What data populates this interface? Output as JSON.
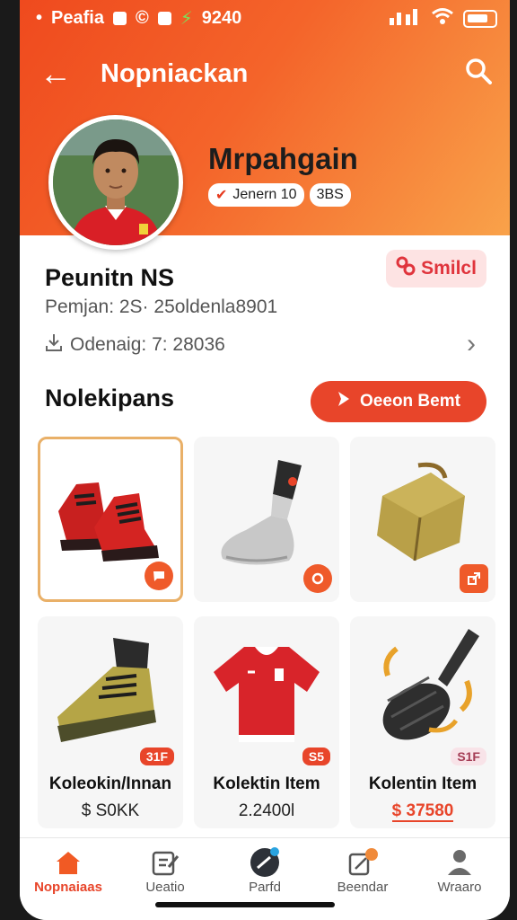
{
  "status_bar": {
    "carrier": "Peafia",
    "time": "9240"
  },
  "nav": {
    "title": "Nopniackan",
    "back_icon": "arrow-left-icon",
    "search_icon": "search-icon"
  },
  "profile": {
    "name": "Mrpahgain",
    "badge_primary": "Jenern 10",
    "badge_secondary": "3BS"
  },
  "info": {
    "title": "Peunitn NS",
    "line1": "Pemjan: 2S· 25oldenla8901",
    "line2": "Odenaig: 7: 28036",
    "action_label": "Smilcl"
  },
  "collection": {
    "title": "Nolekipans",
    "cta_label": "Oeeon Bemt",
    "items": [
      {
        "icon": "red-boots-icon"
      },
      {
        "icon": "shin-guard-icon"
      },
      {
        "icon": "bag-icon"
      },
      {
        "icon": "gold-boot-icon",
        "tag": "31F",
        "name": "Koleokin/Innan",
        "price": "$ S0KK"
      },
      {
        "icon": "red-jersey-icon",
        "tag": "S5",
        "name": "Kolektin Item",
        "price": "2.2400l"
      },
      {
        "icon": "grip-tool-icon",
        "tag": "S1F",
        "name": "Kolentin Item",
        "price": "$ 37580"
      }
    ]
  },
  "bottom_nav": {
    "tabs": [
      {
        "label": "Nopnaiaas",
        "icon": "home-icon"
      },
      {
        "label": "Ueatio",
        "icon": "edit-icon"
      },
      {
        "label": "Parfd",
        "icon": "pen-icon"
      },
      {
        "label": "Beendar",
        "icon": "note-icon"
      },
      {
        "label": "Wraaro",
        "icon": "user-icon"
      }
    ]
  },
  "colors": {
    "accent": "#e8452a",
    "header_start": "#ef4a1e",
    "header_end": "#f9a24a"
  }
}
